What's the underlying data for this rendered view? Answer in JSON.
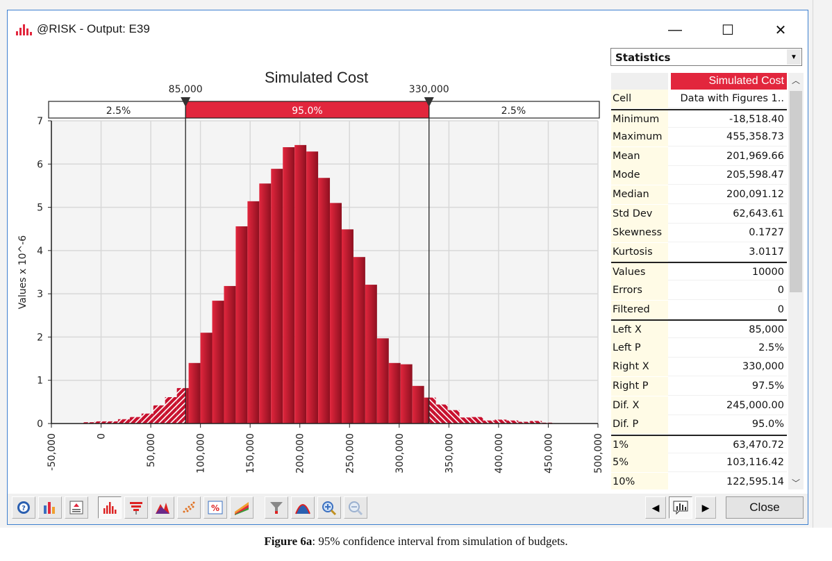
{
  "window": {
    "title": "@RISK - Output: E39",
    "controls": {
      "minimize": "—",
      "maximize": "☐",
      "close": "✕"
    }
  },
  "chart_data": {
    "type": "bar",
    "title": "Simulated Cost",
    "xlabel": "",
    "ylabel": "Values x 10^-6",
    "xlim": [
      -50000,
      500000
    ],
    "ylim": [
      0,
      7
    ],
    "x_ticks": [
      -50000,
      0,
      50000,
      100000,
      150000,
      200000,
      250000,
      300000,
      350000,
      400000,
      450000,
      500000
    ],
    "x_tick_labels": [
      "-50,000",
      "0",
      "50,000",
      "100,000",
      "150,000",
      "200,000",
      "250,000",
      "300,000",
      "350,000",
      "400,000",
      "450,000",
      "500,000"
    ],
    "y_ticks": [
      0,
      1,
      2,
      3,
      4,
      5,
      6,
      7
    ],
    "y_tick_labels": [
      "0",
      "1",
      "2",
      "3",
      "4",
      "5",
      "6",
      "7"
    ],
    "grid": true,
    "bin_start": -18518.4,
    "bin_width": 11847.0,
    "values": [
      0.03,
      0.05,
      0.05,
      0.1,
      0.15,
      0.23,
      0.42,
      0.61,
      0.82,
      1.4,
      2.1,
      2.84,
      3.18,
      4.56,
      5.14,
      5.55,
      5.89,
      6.39,
      6.44,
      6.29,
      5.68,
      5.1,
      4.49,
      3.85,
      3.21,
      1.97,
      1.4,
      1.37,
      0.87,
      0.6,
      0.44,
      0.31,
      0.14,
      0.15,
      0.07,
      0.09,
      0.07,
      0.04,
      0.06,
      0.02
    ],
    "delimiters": {
      "left_x": 85000,
      "left_x_label": "85,000",
      "right_x": 330000,
      "right_x_label": "330,000",
      "left_pct": "2.5%",
      "middle_pct": "95.0%",
      "right_pct": "2.5%"
    },
    "colors": {
      "bar": "#c8102e",
      "bar_dark": "#8e1020",
      "band": "#e2263d",
      "plot_bg": "#f4f4f4"
    }
  },
  "statistics": {
    "dropdown_label": "Statistics",
    "column_header": "Simulated Cost",
    "rows": [
      {
        "label": "Cell",
        "value": "Data with Figures 1.."
      },
      {
        "label": "Minimum",
        "value": "-18,518.40"
      },
      {
        "label": "Maximum",
        "value": "455,358.73"
      },
      {
        "label": "Mean",
        "value": "201,969.66"
      },
      {
        "label": "Mode",
        "value": "205,598.47"
      },
      {
        "label": "Median",
        "value": "200,091.12"
      },
      {
        "label": "Std Dev",
        "value": "62,643.61"
      },
      {
        "label": "Skewness",
        "value": "0.1727"
      },
      {
        "label": "Kurtosis",
        "value": "3.0117"
      },
      {
        "label": "Values",
        "value": "10000"
      },
      {
        "label": "Errors",
        "value": "0"
      },
      {
        "label": "Filtered",
        "value": "0"
      },
      {
        "label": "Left X",
        "value": "85,000"
      },
      {
        "label": "Left P",
        "value": "2.5%"
      },
      {
        "label": "Right X",
        "value": "330,000"
      },
      {
        "label": "Right P",
        "value": "97.5%"
      },
      {
        "label": "Dif. X",
        "value": "245,000.00"
      },
      {
        "label": "Dif. P",
        "value": "95.0%"
      },
      {
        "label": "1%",
        "value": "63,470.72"
      },
      {
        "label": "5%",
        "value": "103,116.42"
      },
      {
        "label": "10%",
        "value": "122,595.14"
      }
    ]
  },
  "toolbar": {
    "buttons": [
      {
        "name": "help-button",
        "icon": "help-icon"
      },
      {
        "name": "graph-options-button",
        "icon": "chart-options-icon"
      },
      {
        "name": "report-button",
        "icon": "report-icon"
      },
      {
        "name": "histogram-button",
        "icon": "histogram-icon",
        "pressed": true
      },
      {
        "name": "tornado-button",
        "icon": "tornado-icon"
      },
      {
        "name": "overlay-button",
        "icon": "overlay-distribution-icon"
      },
      {
        "name": "scatter-button",
        "icon": "scatter-icon"
      },
      {
        "name": "percent-button",
        "icon": "percent-icon"
      },
      {
        "name": "summary-trend-button",
        "icon": "summary-trend-icon"
      },
      {
        "name": "filter-button",
        "icon": "filter-icon"
      },
      {
        "name": "fit-distribution-button",
        "icon": "fit-distribution-icon"
      },
      {
        "name": "zoom-in-button",
        "icon": "zoom-in-icon"
      },
      {
        "name": "zoom-out-button",
        "icon": "zoom-out-icon"
      }
    ],
    "nav_prev": "◀",
    "nav_next": "▶",
    "close_label": "Close"
  },
  "caption": {
    "bold": "Figure 6a",
    "text": ": 95% confidence interval from simulation of budgets."
  }
}
